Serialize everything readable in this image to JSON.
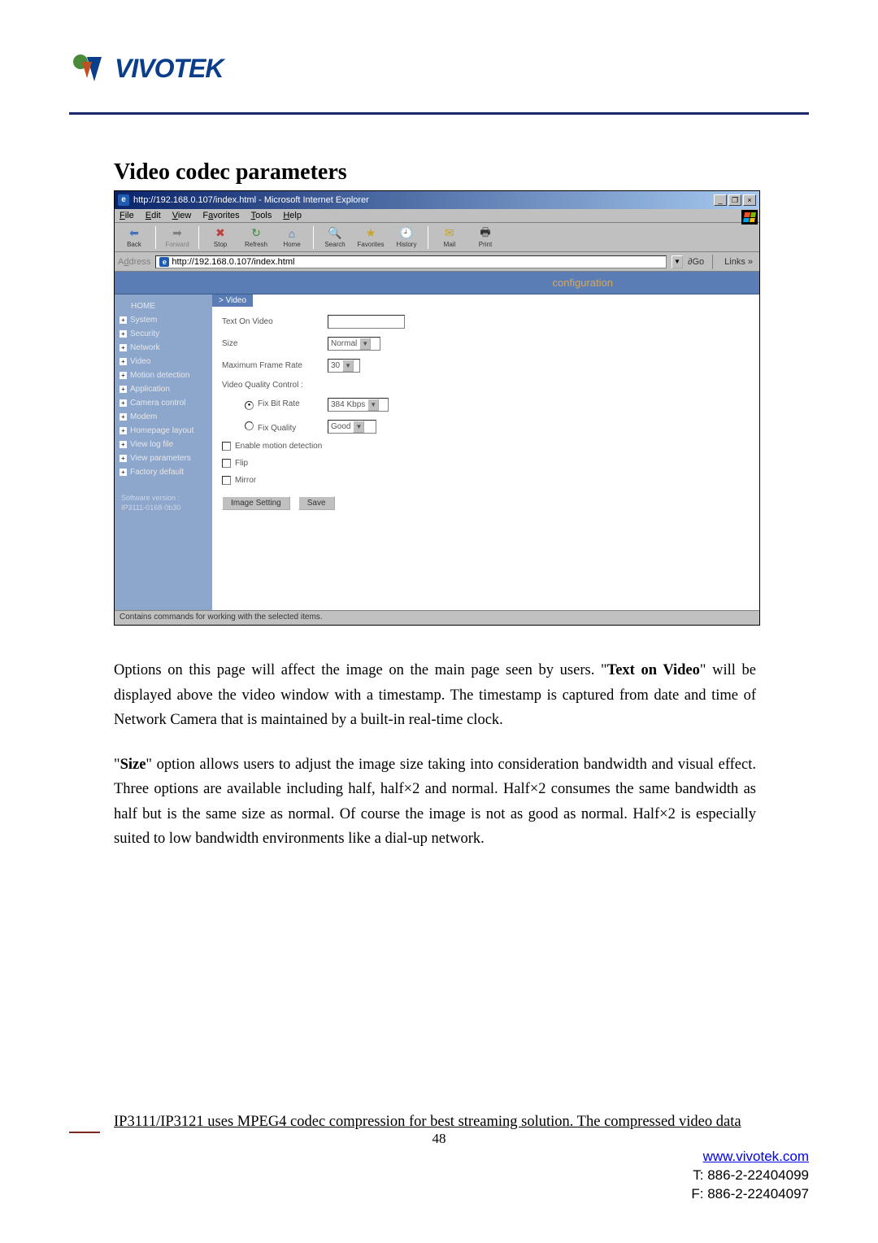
{
  "logo": {
    "text": "VIVOTEK"
  },
  "section_title": "Video codec parameters",
  "ie": {
    "title": "http://192.168.0.107/index.html - Microsoft Internet Explorer",
    "menu": {
      "file": "File",
      "edit": "Edit",
      "view": "View",
      "favorites": "Favorites",
      "tools": "Tools",
      "help": "Help"
    },
    "toolbar": {
      "back": "Back",
      "forward": "Forward",
      "stop": "Stop",
      "refresh": "Refresh",
      "home": "Home",
      "search": "Search",
      "favorites": "Favorites",
      "history": "History",
      "mail": "Mail",
      "print": "Print"
    },
    "address": {
      "label": "Address",
      "value": "http://192.168.0.107/index.html",
      "go": "Go",
      "links": "Links »"
    },
    "status": "Contains commands for working with the selected items."
  },
  "cfg": {
    "header": "configuration",
    "crumb": "> Video",
    "nav": {
      "home": "HOME",
      "items": [
        "System",
        "Security",
        "Network",
        "Video",
        "Motion detection",
        "Application",
        "Camera control",
        "Modem",
        "Homepage layout",
        "View log file",
        "View parameters",
        "Factory default"
      ]
    },
    "sw_version": {
      "label": "Software version :",
      "value": "IP3111-0168-0b30"
    },
    "form": {
      "text_on_video_label": "Text On Video",
      "text_on_video_value": "",
      "size_label": "Size",
      "size_value": "Normal",
      "max_frame_label": "Maximum Frame Rate",
      "max_frame_value": "30",
      "vqc_label": "Video Quality Control :",
      "fix_bitrate_label": "Fix Bit Rate",
      "fix_bitrate_value": "384 Kbps",
      "fix_quality_label": "Fix Quality",
      "fix_quality_value": "Good",
      "enable_motion": "Enable motion detection",
      "flip": "Flip",
      "mirror": "Mirror",
      "image_setting_btn": "Image Setting",
      "save_btn": "Save"
    }
  },
  "body": {
    "p1_pre": "Options on this page will affect the image on the main page seen by users. \"",
    "p1_b1": "Text on Video",
    "p1_mid": "\" will be displayed above the video window with a timestamp. The timestamp is captured from date and time of Network Camera that is maintained by a built-in real-time clock.",
    "p2_pre": "\"",
    "p2_b1": "Size",
    "p2_post": "\" option allows users to adjust the image size taking into consideration bandwidth and visual effect. Three options are available including half, half×2 and normal. Half×2 consumes the same bandwidth as half but is the same size as normal. Of course the image is not as good as normal. Half×2 is especially suited to low bandwidth environments like a dial-up network."
  },
  "footer_line": "IP3111/IP3121 uses MPEG4 codec compression for best streaming solution. The compressed video data",
  "page_num": "48",
  "contact": {
    "url": "www.vivotek.com",
    "tel": "T: 886-2-22404099",
    "fax": "F: 886-2-22404097"
  }
}
